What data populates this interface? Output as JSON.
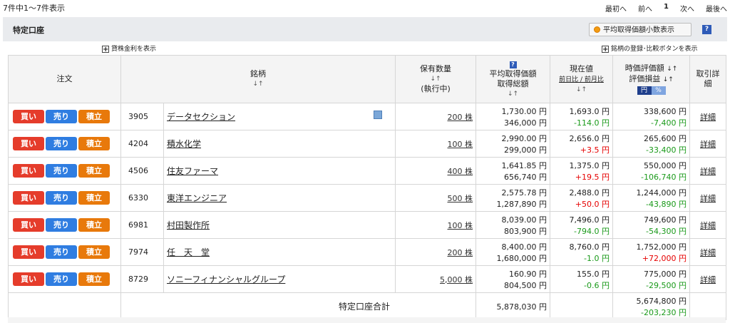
{
  "top": {
    "count_text": "7件中1～7件表示",
    "pager": {
      "first": "最初へ",
      "prev": "前へ",
      "current": "1",
      "next": "次へ",
      "last": "最後へ"
    }
  },
  "account": {
    "title": "特定口座",
    "avg_button": "平均取得価額小数表示",
    "help": "?",
    "lending_toggle": "貸株金利を表示",
    "register_toggle": "銘柄の登録･比較ボタンを表示"
  },
  "headers": {
    "order": "注文",
    "name": "銘柄",
    "qty": "保有数量",
    "qty_sub": "(執行中)",
    "avg1": "平均取得価額",
    "avg2": "取得総額",
    "price": "現在値",
    "price_sub": "前日比 / 前月比",
    "eval1": "時価評価額",
    "eval2": "評価損益",
    "yen": "円",
    "pct": "%",
    "detail": "取引詳細",
    "sort": "↓↑"
  },
  "buttons": {
    "buy": "買い",
    "sell": "売り",
    "reg": "積立"
  },
  "rows": [
    {
      "code": "3905",
      "name": "データセクション",
      "qty": "200 株",
      "avg": "1,730.00 円",
      "total": "346,000 円",
      "price": "1,693.0 円",
      "chg": "-114.0 円",
      "eval": "338,600 円",
      "pl": "-7,400 円",
      "detail": "詳細"
    },
    {
      "code": "4204",
      "name": "積水化学",
      "qty": "100 株",
      "avg": "2,990.00 円",
      "total": "299,000 円",
      "price": "2,656.0 円",
      "chg": "+3.5 円",
      "eval": "265,600 円",
      "pl": "-33,400 円",
      "detail": "詳細"
    },
    {
      "code": "4506",
      "name": "住友ファーマ",
      "qty": "400 株",
      "avg": "1,641.85 円",
      "total": "656,740 円",
      "price": "1,375.0 円",
      "chg": "+19.5 円",
      "eval": "550,000 円",
      "pl": "-106,740 円",
      "detail": "詳細"
    },
    {
      "code": "6330",
      "name": "東洋エンジニア",
      "qty": "500 株",
      "avg": "2,575.78 円",
      "total": "1,287,890 円",
      "price": "2,488.0 円",
      "chg": "+50.0 円",
      "eval": "1,244,000 円",
      "pl": "-43,890 円",
      "detail": "詳細"
    },
    {
      "code": "6981",
      "name": "村田製作所",
      "qty": "100 株",
      "avg": "8,039.00 円",
      "total": "803,900 円",
      "price": "7,496.0 円",
      "chg": "-794.0 円",
      "eval": "749,600 円",
      "pl": "-54,300 円",
      "detail": "詳細"
    },
    {
      "code": "7974",
      "name": "任　天　堂",
      "qty": "200 株",
      "avg": "8,400.00 円",
      "total": "1,680,000 円",
      "price": "8,760.0 円",
      "chg": "-1.0 円",
      "eval": "1,752,000 円",
      "pl": "+72,000 円",
      "detail": "詳細"
    },
    {
      "code": "8729",
      "name": "ソニーフィナンシャルグループ",
      "qty": "5,000 株",
      "avg": "160.90 円",
      "total": "804,500 円",
      "price": "155.0 円",
      "chg": "-0.6 円",
      "eval": "775,000 円",
      "pl": "-29,500 円",
      "detail": "詳細"
    }
  ],
  "total": {
    "label": "特定口座合計",
    "acq_total": "5,878,030 円",
    "eval": "5,674,800 円",
    "pl": "-203,230 円"
  }
}
